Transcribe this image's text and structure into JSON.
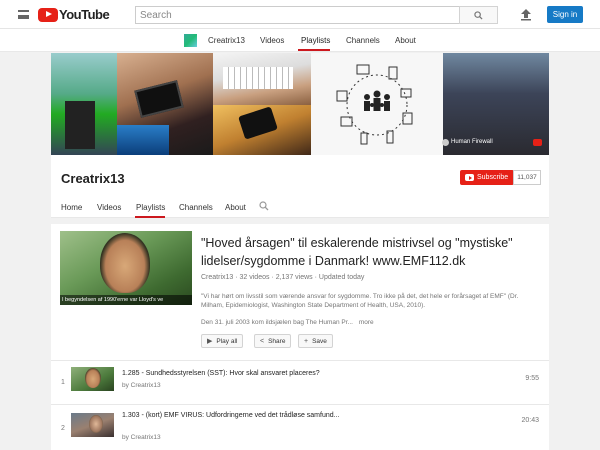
{
  "topbar": {
    "logo_text": "YouTube",
    "search_placeholder": "Search",
    "signin_label": "Sign in",
    "menu_icon": "hamburger-menu-icon",
    "upload_icon": "upload-icon",
    "search_icon": "magnifier-icon"
  },
  "subnav": {
    "channel_name": "Creatrix13",
    "items": [
      "Videos",
      "Playlists",
      "Channels",
      "About"
    ],
    "active": "Playlists"
  },
  "channel": {
    "banner_label": "Human Firewall",
    "name": "Creatrix13",
    "subscribe_label": "Subscribe",
    "subscriber_count": "11,037",
    "tabs": [
      "Home",
      "Videos",
      "Playlists",
      "Channels",
      "About"
    ],
    "active_tab": "Playlists"
  },
  "playlist": {
    "thumb_caption": "I begyndelsen af 1990'erne var Lloyd's ve",
    "title": "\"Hoved årsagen\" til eskalerende mistrivsel og \"mystiske\" lidelser/sygdomme i Danmark! www.EMF112.dk",
    "meta": "Creatrix13 · 32 videos · 2,137 views · Updated today",
    "description": "\"Vi har hørt om livsstil som værende ansvar for sygdomme. Tro ikke på det, det hele er forårsaget af EMF\" (Dr. Milham, Epidemiologist, Washington State Department of Health, USA, 2010).",
    "description2": "Den 31. juli 2003 kom ildsjælen bag The Human Pr...",
    "more_label": "more",
    "buttons": {
      "play_all": "Play all",
      "share": "Share",
      "save": "Save"
    }
  },
  "videos": [
    {
      "index": "1",
      "title": "1.285 - Sundhedsstyrelsen (SST): Hvor skal ansvaret placeres?",
      "by": "by Creatrix13",
      "duration": "9:55"
    },
    {
      "index": "2",
      "title": "1.303 - (kort) EMF VIRUS: Udfordringerne ved det trådløse samfund...",
      "by": "by Creatrix13",
      "duration": "20:43"
    }
  ]
}
